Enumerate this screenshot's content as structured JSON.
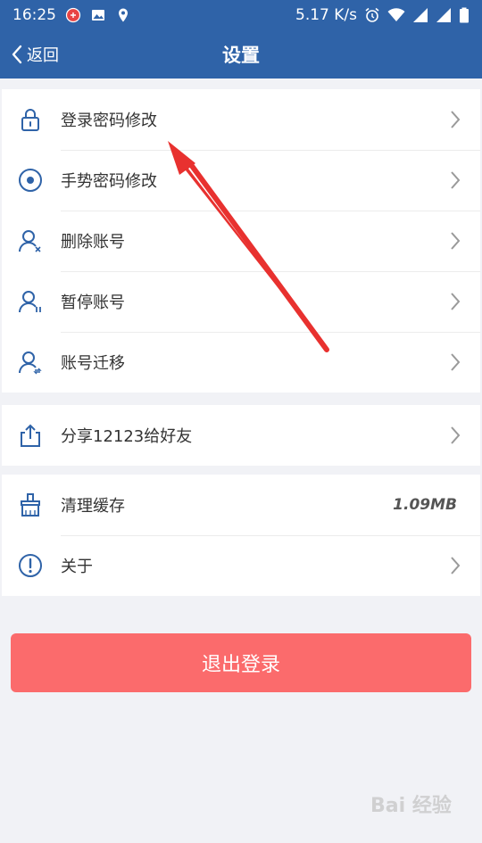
{
  "status_bar": {
    "time": "16:25",
    "net_speed": "5.17 K/s",
    "icons": [
      "app-notification-icon",
      "image-icon",
      "location-icon",
      "alarm-icon",
      "wifi-icon",
      "signal-icon",
      "signal-icon",
      "battery-icon"
    ]
  },
  "nav": {
    "back_label": "返回",
    "title": "设置"
  },
  "account_group": {
    "items": [
      {
        "label": "登录密码修改",
        "icon": "lock-icon"
      },
      {
        "label": "手势密码修改",
        "icon": "gesture-circle-icon"
      },
      {
        "label": "删除账号",
        "icon": "user-delete-icon"
      },
      {
        "label": "暂停账号",
        "icon": "user-pause-icon"
      },
      {
        "label": "账号迁移",
        "icon": "user-migrate-icon"
      }
    ]
  },
  "share_group": {
    "items": [
      {
        "label": "分享12123给好友",
        "icon": "share-icon"
      }
    ]
  },
  "misc_group": {
    "items": [
      {
        "label": "清理缓存",
        "icon": "broom-icon",
        "value": "1.09MB"
      },
      {
        "label": "关于",
        "icon": "info-icon"
      }
    ]
  },
  "logout_label": "退出登录",
  "colors": {
    "header": "#2f63a8",
    "icon": "#2f63a8",
    "logout": "#fb6b6c",
    "annotation_arrow": "#e8312f"
  },
  "watermark": "Bai 经验"
}
